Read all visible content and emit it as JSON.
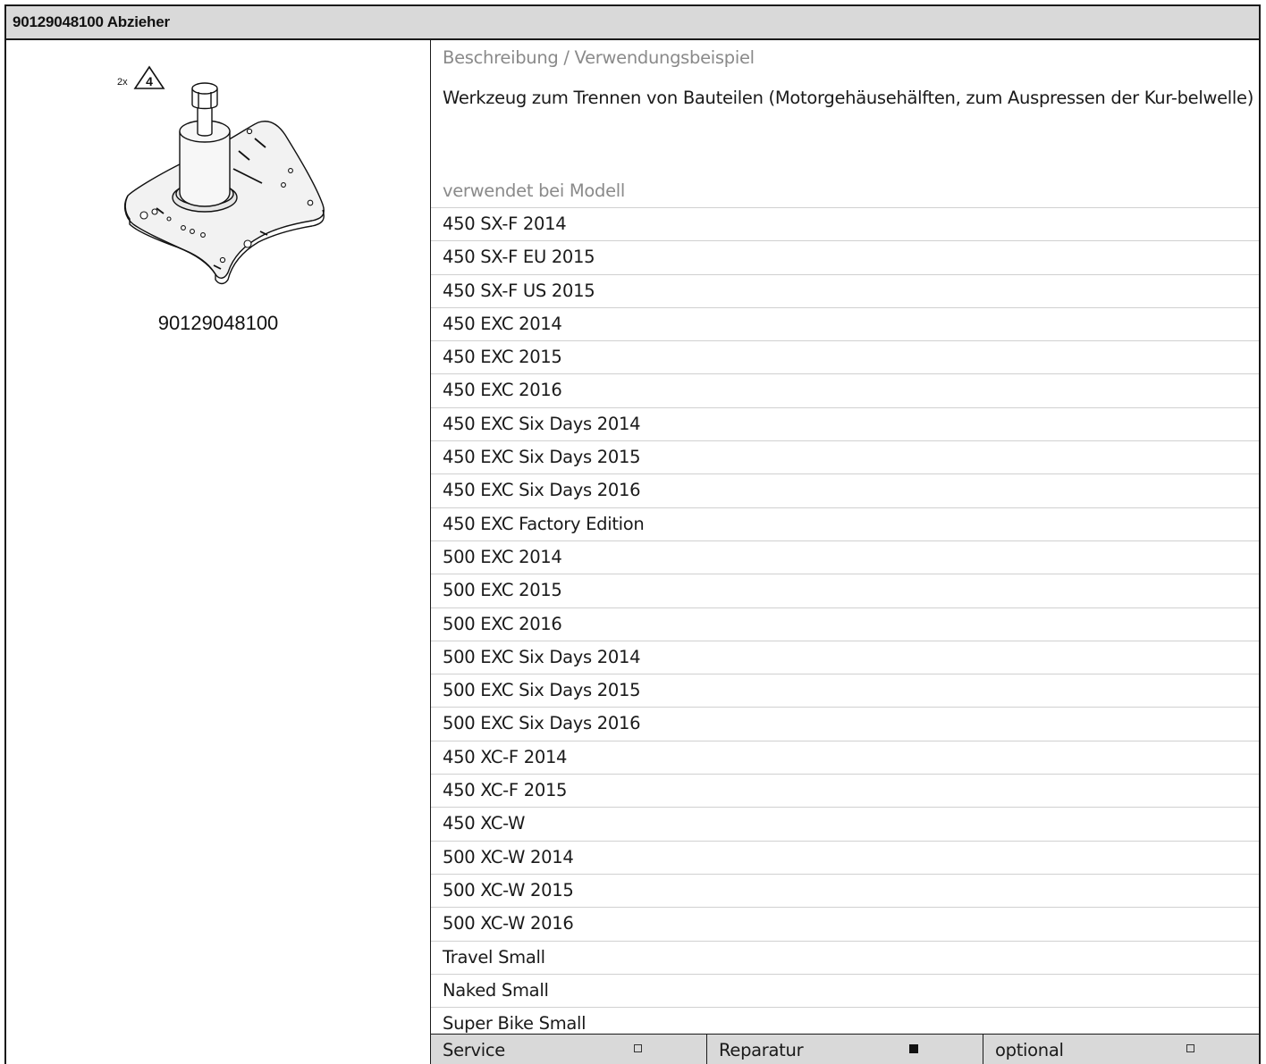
{
  "header": {
    "title": "90129048100 Abzieher"
  },
  "figure": {
    "quantity": "2x",
    "badge": "4",
    "part_number": "90129048100"
  },
  "description": {
    "label": "Beschreibung / Verwendungsbeispiel",
    "text": "Werkzeug zum Trennen von Bauteilen (Motorgehäusehälften, zum Auspressen der Kur-belwelle)"
  },
  "models": {
    "label": "verwendet bei Modell",
    "items": [
      "450 SX-F 2014",
      "450 SX-F EU 2015",
      "450 SX-F US 2015",
      "450 EXC 2014",
      "450 EXC 2015",
      "450 EXC 2016",
      "450 EXC Six Days 2014",
      "450 EXC Six Days 2015",
      "450 EXC Six Days 2016",
      "450 EXC Factory Edition",
      "500 EXC 2014",
      "500 EXC 2015",
      "500 EXC 2016",
      "500 EXC Six Days 2014",
      "500 EXC Six Days 2015",
      "500 EXC Six Days 2016",
      "450 XC-F 2014",
      "450 XC-F 2015",
      "450 XC-W",
      "500 XC-W 2014",
      "500 XC-W 2015",
      "500 XC-W 2016",
      "Travel Small",
      "Naked Small",
      "Super Bike Small"
    ]
  },
  "usage": [
    {
      "label": "Service",
      "checked": false
    },
    {
      "label": "Reparatur",
      "checked": true
    },
    {
      "label": "optional",
      "checked": false
    }
  ]
}
